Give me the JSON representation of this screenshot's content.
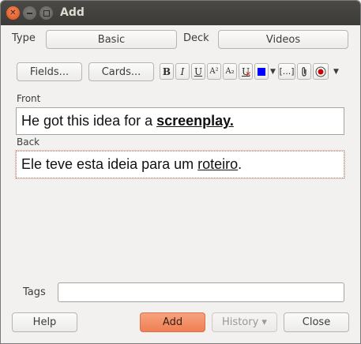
{
  "window": {
    "title": "Add"
  },
  "header": {
    "type_label": "Type",
    "type_value": "Basic",
    "deck_label": "Deck",
    "deck_value": "Videos"
  },
  "toolbar": {
    "fields_button": "Fields...",
    "cards_button": "Cards...",
    "bold": "B",
    "italic": "I",
    "underline": "U",
    "superscript": "A²",
    "subscript": "A₂",
    "clear_format": "U",
    "cloze": "[...]",
    "attach_icon": "paperclip-icon",
    "record_icon": "record-icon",
    "text_color": "#0000ff",
    "record_color": "#cc0000"
  },
  "fields": [
    {
      "label": "Front",
      "content_prefix": "He got this idea for a ",
      "content_emphasis": "screenplay."
    },
    {
      "label": "Back",
      "content_prefix": "Ele teve esta ideia para um ",
      "content_emphasis": "roteiro",
      "content_suffix": "."
    }
  ],
  "tags": {
    "label": "Tags",
    "value": ""
  },
  "footer": {
    "help_button": "Help",
    "add_button": "Add",
    "history_button": "History ▾",
    "close_button": "Close"
  }
}
